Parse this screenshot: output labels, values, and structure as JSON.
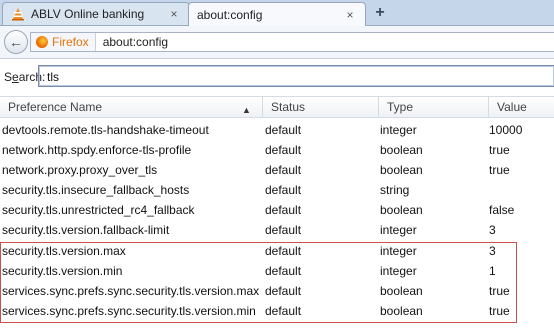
{
  "tabs": [
    {
      "title": "ABLV Online banking",
      "favicon": "vlc-cone-icon",
      "close": "×"
    },
    {
      "title": "about:config",
      "close": "×"
    }
  ],
  "new_tab": "+",
  "nav": {
    "back": "←",
    "identity_label": "Firefox",
    "url": "about:config"
  },
  "search": {
    "label_prefix": "S",
    "label_underlined": "e",
    "label_suffix": "arch:",
    "value": "tls"
  },
  "columns": {
    "name": "Preference Name",
    "status": "Status",
    "type": "Type",
    "value": "Value",
    "sort": "▲"
  },
  "rows": [
    {
      "name": "devtools.remote.tls-handshake-timeout",
      "status": "default",
      "type": "integer",
      "value": "10000"
    },
    {
      "name": "network.http.spdy.enforce-tls-profile",
      "status": "default",
      "type": "boolean",
      "value": "true"
    },
    {
      "name": "network.proxy.proxy_over_tls",
      "status": "default",
      "type": "boolean",
      "value": "true"
    },
    {
      "name": "security.tls.insecure_fallback_hosts",
      "status": "default",
      "type": "string",
      "value": ""
    },
    {
      "name": "security.tls.unrestricted_rc4_fallback",
      "status": "default",
      "type": "boolean",
      "value": "false"
    },
    {
      "name": "security.tls.version.fallback-limit",
      "status": "default",
      "type": "integer",
      "value": "3"
    },
    {
      "name": "security.tls.version.max",
      "status": "default",
      "type": "integer",
      "value": "3"
    },
    {
      "name": "security.tls.version.min",
      "status": "default",
      "type": "integer",
      "value": "1"
    },
    {
      "name": "services.sync.prefs.sync.security.tls.version.max",
      "status": "default",
      "type": "boolean",
      "value": "true"
    },
    {
      "name": "services.sync.prefs.sync.security.tls.version.min",
      "status": "default",
      "type": "boolean",
      "value": "true"
    }
  ],
  "colors": {
    "highlight_border": "#c9504c",
    "identity_text": "#e2740f"
  }
}
